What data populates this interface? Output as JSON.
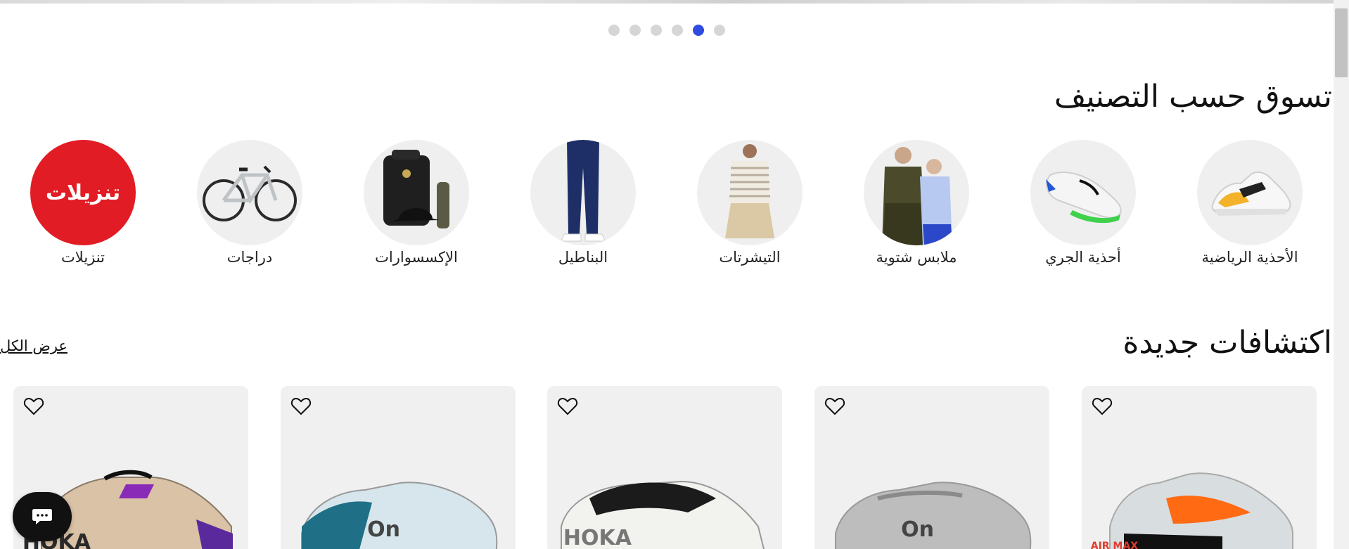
{
  "carousel": {
    "total": 6,
    "active_index": 4
  },
  "categories_section": {
    "title": "تسوق حسب التصنيف",
    "items": [
      {
        "label": "الأحذية الرياضية",
        "icon": "sneaker-icon"
      },
      {
        "label": "أحذية الجري",
        "icon": "running-shoe-icon"
      },
      {
        "label": "ملابس شتوية",
        "icon": "winter-jacket-icon"
      },
      {
        "label": "التيشرتات",
        "icon": "tshirt-icon"
      },
      {
        "label": "البناطيل",
        "icon": "pants-icon"
      },
      {
        "label": "الإكسسوارات",
        "icon": "accessories-icon"
      },
      {
        "label": "دراجات",
        "icon": "bicycle-icon"
      },
      {
        "label": "تنزيلات",
        "badge_text": "تنزيلات",
        "badge_color": "#e21c24"
      }
    ]
  },
  "new_arrivals": {
    "title": "اكتشافات جديدة",
    "view_all": "عرض الكل",
    "products": [
      {
        "brand_mark": "AIR MAX",
        "icon": "nike-shoe-icon"
      },
      {
        "brand_mark": "On",
        "icon": "on-shoe-icon"
      },
      {
        "brand_mark": "HOKA",
        "icon": "hoka-shoe-icon"
      },
      {
        "brand_mark": "On",
        "icon": "on-shoe-icon"
      },
      {
        "brand_mark": "HOKA",
        "icon": "hoka-shoe-icon"
      }
    ]
  },
  "colors": {
    "accent": "#2f4be0",
    "sale": "#e21c24",
    "card_bg": "#f0f0f0"
  },
  "chat": {
    "icon": "chat-bubble-icon"
  }
}
